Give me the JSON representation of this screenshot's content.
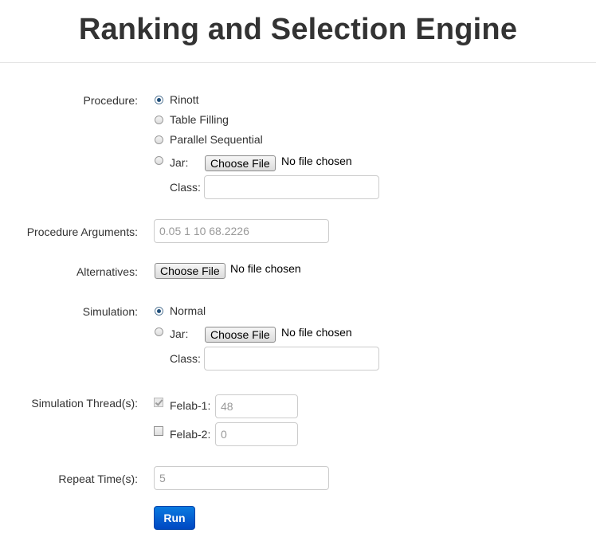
{
  "header": {
    "title": "Ranking and Selection Engine"
  },
  "procedure": {
    "label": "Procedure:",
    "options": [
      {
        "label": "Rinott",
        "selected": true
      },
      {
        "label": "Table Filling",
        "selected": false
      },
      {
        "label": "Parallel Sequential",
        "selected": false
      },
      {
        "label": "Jar:",
        "selected": false
      }
    ],
    "jar_button": "Choose File",
    "jar_status": "No file chosen",
    "class_label": "Class:",
    "class_value": ""
  },
  "procedure_arguments": {
    "label": "Procedure Arguments:",
    "placeholder": "0.05 1 10 68.2226"
  },
  "alternatives": {
    "label": "Alternatives:",
    "button": "Choose File",
    "status": "No file chosen"
  },
  "simulation": {
    "label": "Simulation:",
    "options": [
      {
        "label": "Normal",
        "selected": true
      },
      {
        "label": "Jar:",
        "selected": false
      }
    ],
    "jar_button": "Choose File",
    "jar_status": "No file chosen",
    "class_label": "Class:",
    "class_value": ""
  },
  "threads": {
    "label": "Simulation Thread(s):",
    "items": [
      {
        "label": "Felab-1:",
        "checked": true,
        "disabled": true,
        "placeholder": "48"
      },
      {
        "label": "Felab-2:",
        "checked": false,
        "disabled": false,
        "placeholder": "0"
      }
    ]
  },
  "repeat": {
    "label": "Repeat Time(s):",
    "placeholder": "5"
  },
  "run_button": "Run"
}
